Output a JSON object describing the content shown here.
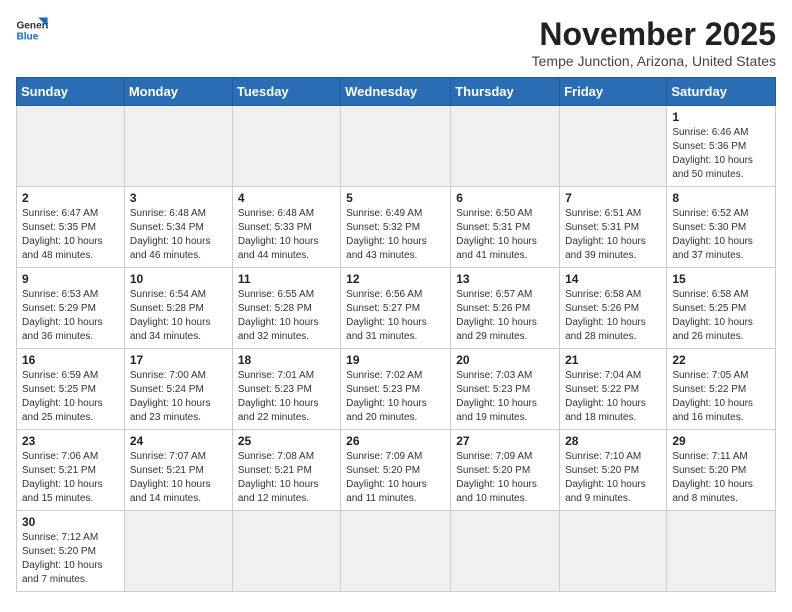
{
  "header": {
    "logo_general": "General",
    "logo_blue": "Blue",
    "month_title": "November 2025",
    "location": "Tempe Junction, Arizona, United States"
  },
  "days_of_week": [
    "Sunday",
    "Monday",
    "Tuesday",
    "Wednesday",
    "Thursday",
    "Friday",
    "Saturday"
  ],
  "weeks": [
    [
      {
        "day": "",
        "info": ""
      },
      {
        "day": "",
        "info": ""
      },
      {
        "day": "",
        "info": ""
      },
      {
        "day": "",
        "info": ""
      },
      {
        "day": "",
        "info": ""
      },
      {
        "day": "",
        "info": ""
      },
      {
        "day": "1",
        "info": "Sunrise: 6:46 AM\nSunset: 5:36 PM\nDaylight: 10 hours\nand 50 minutes."
      }
    ],
    [
      {
        "day": "2",
        "info": "Sunrise: 6:47 AM\nSunset: 5:35 PM\nDaylight: 10 hours\nand 48 minutes."
      },
      {
        "day": "3",
        "info": "Sunrise: 6:48 AM\nSunset: 5:34 PM\nDaylight: 10 hours\nand 46 minutes."
      },
      {
        "day": "4",
        "info": "Sunrise: 6:48 AM\nSunset: 5:33 PM\nDaylight: 10 hours\nand 44 minutes."
      },
      {
        "day": "5",
        "info": "Sunrise: 6:49 AM\nSunset: 5:32 PM\nDaylight: 10 hours\nand 43 minutes."
      },
      {
        "day": "6",
        "info": "Sunrise: 6:50 AM\nSunset: 5:31 PM\nDaylight: 10 hours\nand 41 minutes."
      },
      {
        "day": "7",
        "info": "Sunrise: 6:51 AM\nSunset: 5:31 PM\nDaylight: 10 hours\nand 39 minutes."
      },
      {
        "day": "8",
        "info": "Sunrise: 6:52 AM\nSunset: 5:30 PM\nDaylight: 10 hours\nand 37 minutes."
      }
    ],
    [
      {
        "day": "9",
        "info": "Sunrise: 6:53 AM\nSunset: 5:29 PM\nDaylight: 10 hours\nand 36 minutes."
      },
      {
        "day": "10",
        "info": "Sunrise: 6:54 AM\nSunset: 5:28 PM\nDaylight: 10 hours\nand 34 minutes."
      },
      {
        "day": "11",
        "info": "Sunrise: 6:55 AM\nSunset: 5:28 PM\nDaylight: 10 hours\nand 32 minutes."
      },
      {
        "day": "12",
        "info": "Sunrise: 6:56 AM\nSunset: 5:27 PM\nDaylight: 10 hours\nand 31 minutes."
      },
      {
        "day": "13",
        "info": "Sunrise: 6:57 AM\nSunset: 5:26 PM\nDaylight: 10 hours\nand 29 minutes."
      },
      {
        "day": "14",
        "info": "Sunrise: 6:58 AM\nSunset: 5:26 PM\nDaylight: 10 hours\nand 28 minutes."
      },
      {
        "day": "15",
        "info": "Sunrise: 6:58 AM\nSunset: 5:25 PM\nDaylight: 10 hours\nand 26 minutes."
      }
    ],
    [
      {
        "day": "16",
        "info": "Sunrise: 6:59 AM\nSunset: 5:25 PM\nDaylight: 10 hours\nand 25 minutes."
      },
      {
        "day": "17",
        "info": "Sunrise: 7:00 AM\nSunset: 5:24 PM\nDaylight: 10 hours\nand 23 minutes."
      },
      {
        "day": "18",
        "info": "Sunrise: 7:01 AM\nSunset: 5:23 PM\nDaylight: 10 hours\nand 22 minutes."
      },
      {
        "day": "19",
        "info": "Sunrise: 7:02 AM\nSunset: 5:23 PM\nDaylight: 10 hours\nand 20 minutes."
      },
      {
        "day": "20",
        "info": "Sunrise: 7:03 AM\nSunset: 5:23 PM\nDaylight: 10 hours\nand 19 minutes."
      },
      {
        "day": "21",
        "info": "Sunrise: 7:04 AM\nSunset: 5:22 PM\nDaylight: 10 hours\nand 18 minutes."
      },
      {
        "day": "22",
        "info": "Sunrise: 7:05 AM\nSunset: 5:22 PM\nDaylight: 10 hours\nand 16 minutes."
      }
    ],
    [
      {
        "day": "23",
        "info": "Sunrise: 7:06 AM\nSunset: 5:21 PM\nDaylight: 10 hours\nand 15 minutes."
      },
      {
        "day": "24",
        "info": "Sunrise: 7:07 AM\nSunset: 5:21 PM\nDaylight: 10 hours\nand 14 minutes."
      },
      {
        "day": "25",
        "info": "Sunrise: 7:08 AM\nSunset: 5:21 PM\nDaylight: 10 hours\nand 12 minutes."
      },
      {
        "day": "26",
        "info": "Sunrise: 7:09 AM\nSunset: 5:20 PM\nDaylight: 10 hours\nand 11 minutes."
      },
      {
        "day": "27",
        "info": "Sunrise: 7:09 AM\nSunset: 5:20 PM\nDaylight: 10 hours\nand 10 minutes."
      },
      {
        "day": "28",
        "info": "Sunrise: 7:10 AM\nSunset: 5:20 PM\nDaylight: 10 hours\nand 9 minutes."
      },
      {
        "day": "29",
        "info": "Sunrise: 7:11 AM\nSunset: 5:20 PM\nDaylight: 10 hours\nand 8 minutes."
      }
    ],
    [
      {
        "day": "30",
        "info": "Sunrise: 7:12 AM\nSunset: 5:20 PM\nDaylight: 10 hours\nand 7 minutes."
      },
      {
        "day": "",
        "info": ""
      },
      {
        "day": "",
        "info": ""
      },
      {
        "day": "",
        "info": ""
      },
      {
        "day": "",
        "info": ""
      },
      {
        "day": "",
        "info": ""
      },
      {
        "day": "",
        "info": ""
      }
    ]
  ]
}
